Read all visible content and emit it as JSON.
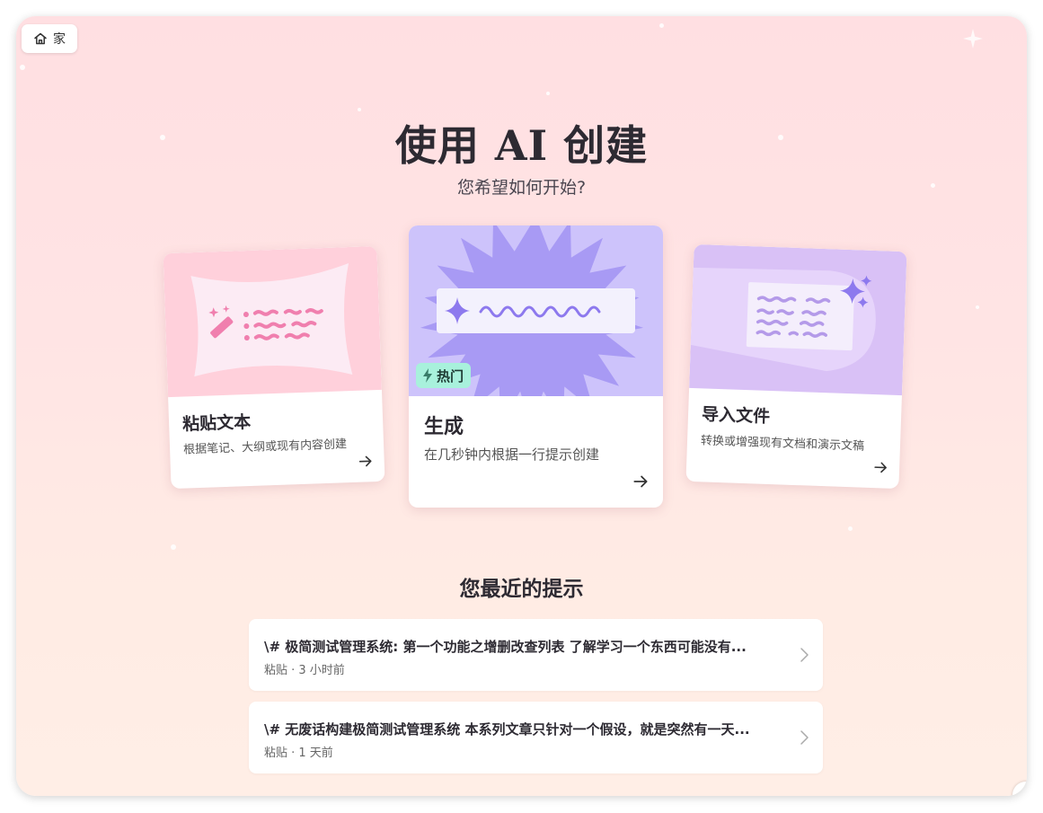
{
  "nav": {
    "home_label": "家",
    "home_icon": "home-icon"
  },
  "hero": {
    "title": "使用 AI 创建",
    "subtitle": "您希望如何开始?"
  },
  "options": [
    {
      "label": "粘贴文本",
      "description": "根据笔记、大纲或现有内容创建",
      "icon": "magic-wand-icon"
    },
    {
      "label": "生成",
      "description": "在几秒钟内根据一行提示创建",
      "badge": "热门",
      "badge_icon": "lightning-icon"
    },
    {
      "label": "导入文件",
      "description": "转换或增强现有文档和演示文稿",
      "icon": "sparkle-icon"
    }
  ],
  "recent": {
    "heading": "您最近的提示",
    "items": [
      {
        "title": "\\# 极简测试管理系统: 第一个功能之增删改查列表 了解学习一个东西可能没有...",
        "meta": "粘贴 · 3 小时前"
      },
      {
        "title": "\\# 无废话构建极简测试管理系统 本系列文章只针对一个假设，就是突然有一天...",
        "meta": "粘贴 · 1 天前"
      }
    ]
  },
  "colors": {
    "paste_card": "#ffd0db",
    "generate_card": "#cdc3fb",
    "import_card": "#d9c1f6",
    "badge": "#a8f1dc",
    "paste_accent": "#f07fae",
    "purple_accent": "#8d79ee"
  }
}
